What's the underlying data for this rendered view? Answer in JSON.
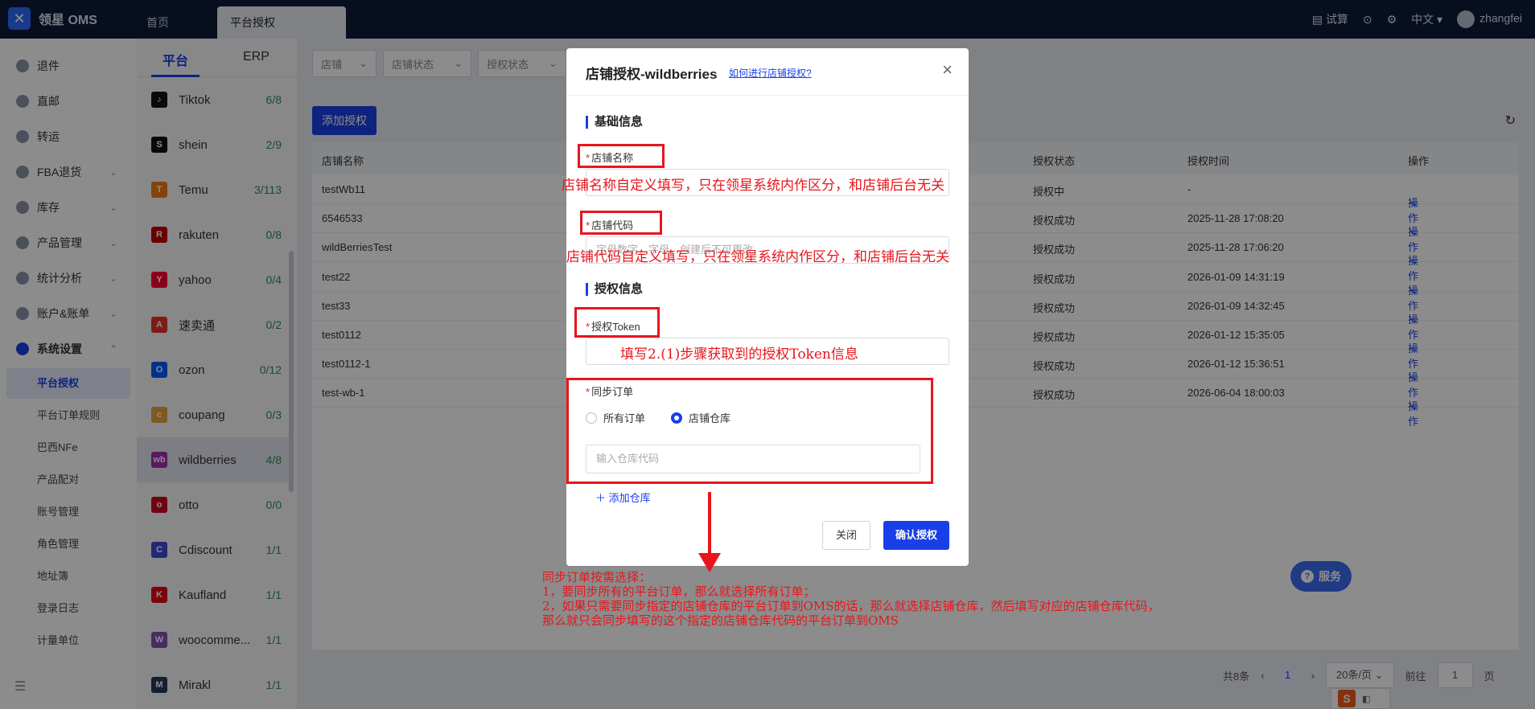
{
  "app": {
    "logo_text": "领星 OMS"
  },
  "tabs": {
    "home": "首页",
    "active": "平台授权"
  },
  "topbar": {
    "trial": "试算",
    "language": "中文",
    "user": "zhangfei"
  },
  "sidebar": {
    "items": [
      {
        "label": "退件"
      },
      {
        "label": "直邮"
      },
      {
        "label": "转运"
      },
      {
        "label": "FBA退货"
      },
      {
        "label": "库存"
      },
      {
        "label": "产品管理"
      },
      {
        "label": "统计分析"
      },
      {
        "label": "账户&账单"
      },
      {
        "label": "系统设置"
      }
    ],
    "sub_items": [
      {
        "label": "平台授权"
      },
      {
        "label": "平台订单规则"
      },
      {
        "label": "巴西NFe"
      },
      {
        "label": "产品配对"
      },
      {
        "label": "账号管理"
      },
      {
        "label": "角色管理"
      },
      {
        "label": "地址簿"
      },
      {
        "label": "登录日志"
      },
      {
        "label": "计量单位"
      }
    ]
  },
  "platform_tabs": {
    "platform": "平台",
    "erp": "ERP"
  },
  "platforms": [
    {
      "name": "Tiktok",
      "count": "6/8",
      "color": "#111111",
      "glyph": "♪"
    },
    {
      "name": "shein",
      "count": "2/9",
      "color": "#111111",
      "glyph": "S"
    },
    {
      "name": "Temu",
      "count": "3/113",
      "color": "#f07c12",
      "glyph": "T"
    },
    {
      "name": "rakuten",
      "count": "0/8",
      "color": "#bf0000",
      "glyph": "R"
    },
    {
      "name": "yahoo",
      "count": "0/4",
      "color": "#ff0033",
      "glyph": "Y"
    },
    {
      "name": "速卖通",
      "count": "0/2",
      "color": "#e43225",
      "glyph": "A"
    },
    {
      "name": "ozon",
      "count": "0/12",
      "color": "#005bff",
      "glyph": "O"
    },
    {
      "name": "coupang",
      "count": "0/3",
      "color": "#e8a33c",
      "glyph": "c"
    },
    {
      "name": "wildberries",
      "count": "4/8",
      "color": "#a72ab0",
      "glyph": "wb"
    },
    {
      "name": "otto",
      "count": "0/0",
      "color": "#d4021d",
      "glyph": "o"
    },
    {
      "name": "Cdiscount",
      "count": "1/1",
      "color": "#3a4bd8",
      "glyph": "C"
    },
    {
      "name": "Kaufland",
      "count": "1/1",
      "color": "#e10915",
      "glyph": "K"
    },
    {
      "name": "woocomme...",
      "count": "1/1",
      "color": "#7f54b3",
      "glyph": "W"
    },
    {
      "name": "Mirakl",
      "count": "1/1",
      "color": "#27375c",
      "glyph": "M"
    }
  ],
  "filters": {
    "shop": "店铺",
    "shop_status": "店铺状态",
    "auth_status": "授权状态"
  },
  "toolbar": {
    "add_auth": "添加授权"
  },
  "table": {
    "headers": {
      "name": "店铺名称",
      "status": "授权状态",
      "time": "授权时间",
      "op": "操作"
    },
    "rows": [
      {
        "name": "testWb11",
        "status": "授权中",
        "time": "-",
        "op": "操作"
      },
      {
        "name": "6546533",
        "status": "授权成功",
        "time": "2025-11-28 17:08:20",
        "op": "操作"
      },
      {
        "name": "wildBerriesTest",
        "status": "授权成功",
        "time": "2025-11-28 17:06:20",
        "op": "操作"
      },
      {
        "name": "test22",
        "status": "授权成功",
        "time": "2026-01-09 14:31:19",
        "op": "操作"
      },
      {
        "name": "test33",
        "status": "授权成功",
        "time": "2026-01-09 14:32:45",
        "op": "操作"
      },
      {
        "name": "test0112",
        "status": "授权成功",
        "time": "2026-01-12 15:35:05",
        "op": "操作"
      },
      {
        "name": "test0112-1",
        "status": "授权成功",
        "time": "2026-01-12 15:36:51",
        "op": "操作"
      },
      {
        "name": "test-wb-1",
        "status": "授权成功",
        "time": "2026-06-04 18:00:03",
        "op": "操作"
      }
    ]
  },
  "pager": {
    "total": "共8条",
    "page": "1",
    "page_size": "20条/页",
    "goto_prefix": "前往",
    "goto_value": "1",
    "goto_suffix": "页"
  },
  "service": {
    "label": "服务"
  },
  "modal": {
    "title": "店铺授权-wildberries",
    "help_link": "如何进行店铺授权?",
    "section_basic": "基础信息",
    "shop_name_label": "店铺名称",
    "shop_code_label": "店铺代码",
    "shop_code_placeholder": "字母数字，字母，创建后不可更改",
    "section_auth": "授权信息",
    "token_label": "授权Token",
    "sync_label": "同步订单",
    "radio_all": "所有订单",
    "radio_warehouse": "店铺仓库",
    "warehouse_placeholder": "输入仓库代码",
    "add_warehouse": "添加仓库",
    "close_btn": "关闭",
    "confirm_btn": "确认授权"
  },
  "annotations": {
    "shop_name_note": "店铺名称自定义填写，只在领星系统内作区分，和店铺后台无关",
    "shop_code_note": "店铺代码自定义填写，只在领星系统内作区分，和店铺后台无关",
    "token_note": "填写2.(1)步骤获取到的授权Token信息",
    "sync_note_lines": [
      "同步订单按需选择：",
      "1，要同步所有的平台订单，那么就选择所有订单；",
      "2，如果只需要同步指定的店铺仓库的平台订单到OMS的话，那么就选择店铺仓库，然后填写对应的店铺仓库代码，",
      "那么就只会同步填写的这个指定的店铺仓库代码的平台订单到OMS"
    ]
  },
  "colors": {
    "brand": "#1a3ee8",
    "annotation": "#e8151c",
    "topbar": "#0d1a38"
  }
}
